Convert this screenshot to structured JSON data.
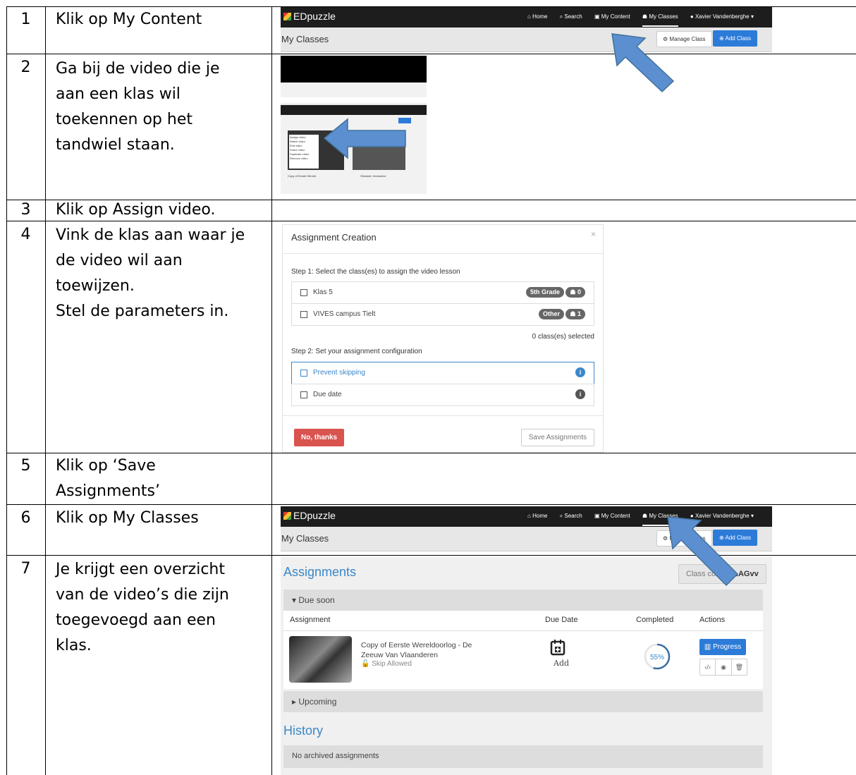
{
  "rows": [
    {
      "num": "1",
      "text": "Klik op My Content"
    },
    {
      "num": "2",
      "text": "Ga bij de video die je\naan een klas wil\ntoekennen op het\ntandwiel staan."
    },
    {
      "num": "3",
      "text": "Klik op Assign video."
    },
    {
      "num": "4",
      "text": "Vink de klas aan waar je\nde video wil aan\ntoewijzen.\nStel de parameters in."
    },
    {
      "num": "5",
      "text": "Klik op ‘Save\nAssignments’"
    },
    {
      "num": "6",
      "text": "Klik op My Classes"
    },
    {
      "num": "7",
      "text": "Je krijgt een overzicht\nvan de video’s die zijn\ntoegevoegd aan een\nklas."
    }
  ],
  "edpuzzle": {
    "logo": "EDpuzzle",
    "nav": {
      "home": "Home",
      "search": "Search",
      "content": "My Content",
      "classes": "My Classes",
      "user": "Xavier Vandenberghe"
    },
    "page_title": "My Classes",
    "manage_class": "Manage Class",
    "add_class": "Add Class"
  },
  "modal": {
    "title": "Assignment Creation",
    "close": "×",
    "step1_prefix": "Step 1",
    "step1_text": ": Select the class(es) to assign the video lesson",
    "classes": [
      {
        "name": "Klas 5",
        "tag": "5th Grade",
        "count": "0"
      },
      {
        "name": "VIVES campus Tielt",
        "tag": "Other",
        "count": "1"
      }
    ],
    "selected": "0 class(es) selected",
    "step2_prefix": "Step 2",
    "step2_text": ": Set your assignment configuration",
    "prevent": "Prevent skipping",
    "due": "Due date",
    "no_thanks": "No, thanks",
    "save": "Save Assignments"
  },
  "assignments": {
    "title": "Assignments",
    "class_code_label": "Class code:",
    "class_code": "dLAGvv",
    "due_soon": "Due soon",
    "col_assignment": "Assignment",
    "col_due": "Due Date",
    "col_completed": "Completed",
    "col_actions": "Actions",
    "video_title": "Copy of Eerste Wereldoorlog - De Zeeuw Van Vlaanderen",
    "skip": "Skip Allowed",
    "add": "Add",
    "progress_percent": 55,
    "progress_label": "55%",
    "progress_btn": "Progress",
    "upcoming": "Upcoming",
    "history": "History",
    "no_archived": "No archived assignments"
  },
  "thumb2": {
    "menu_items": [
      "Assign video",
      "Watch video",
      "Edit video",
      "Share video",
      "Duplicate video",
      "Remove video"
    ],
    "card1": "Copy of Eerste Wereld",
    "card2": "Obstacle: Interactive"
  },
  "colors": {
    "accent": "#3a87c8",
    "arrow": "#5b8fcf",
    "danger": "#d9534f",
    "navbar": "#1d1d1d"
  }
}
